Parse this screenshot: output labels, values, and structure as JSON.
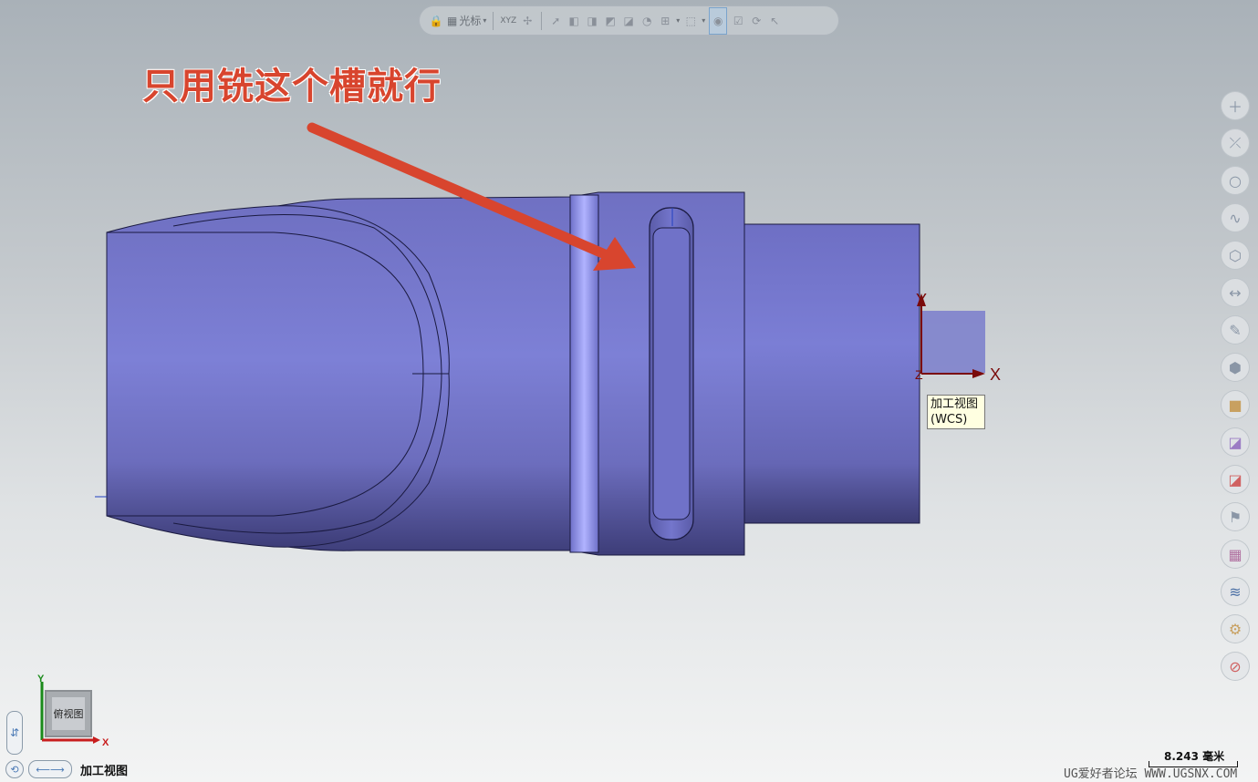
{
  "toolbar": {
    "cursor_label": "光标",
    "coord_label": "XYZ"
  },
  "annotation": {
    "text": "只用铣这个槽就行"
  },
  "wcs": {
    "x_label": "X",
    "y_label": "Y",
    "z_label": "Z",
    "tooltip_line1": "加工视图",
    "tooltip_line2": "(WCS)"
  },
  "right_toolbar": {
    "icons": [
      "plus-icon",
      "point-on-curve-icon",
      "circle-icon",
      "spline-icon",
      "solid-icon",
      "dimension-icon",
      "pencil-icon",
      "cube-icon",
      "box-icon",
      "layers-color-icon",
      "layers-red-icon",
      "flag-icon",
      "grid-icon",
      "layer-stack-icon",
      "gear-icon",
      "prohibit-icon"
    ]
  },
  "triad": {
    "x_label": "X",
    "y_label": "Y",
    "cube_label": "俯视图"
  },
  "status": {
    "view_name": "加工视图",
    "scale_value": "8.243 毫米",
    "watermark": "UG爱好者论坛 WWW.UGSNX.COM"
  },
  "colors": {
    "part_body": "#7b7dcc",
    "annotation": "#d8452e",
    "wcs_axis": "#7a0a0a"
  }
}
